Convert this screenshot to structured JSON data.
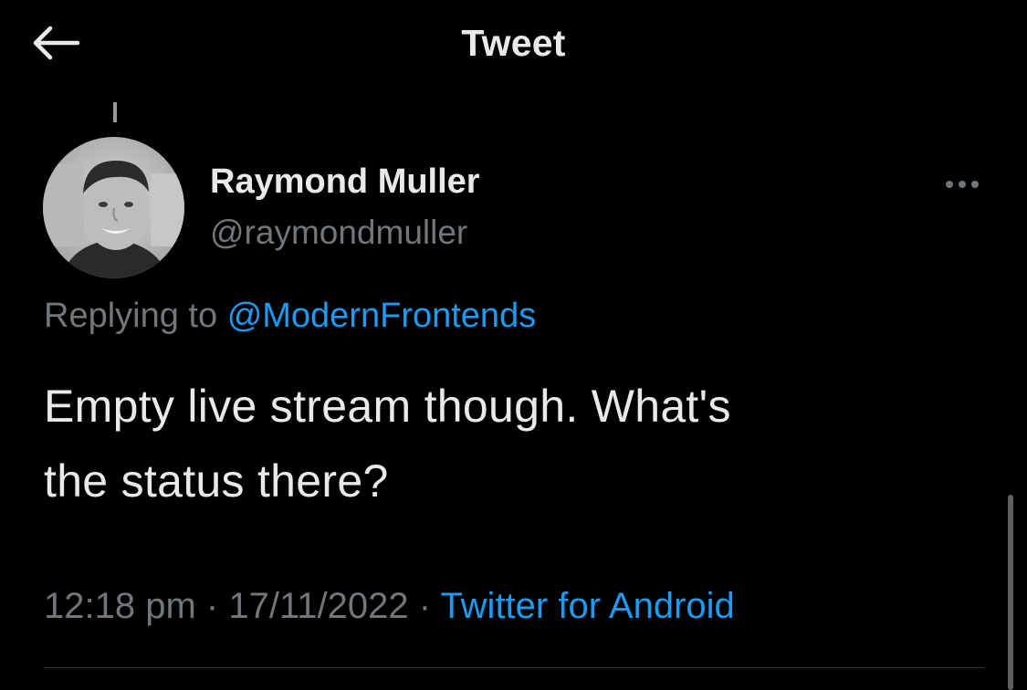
{
  "header": {
    "back_icon": "arrow-left-icon",
    "title": "Tweet"
  },
  "tweet": {
    "author": {
      "display_name": "Raymond Muller",
      "handle": "@raymondmuller",
      "avatar": "profile-photo"
    },
    "more_icon": "more-horizontal-icon",
    "replying_prefix": "Replying to",
    "replying_to": "@ModernFrontends",
    "text_line1": "Empty live stream though. What's",
    "text_line2": "the status there?",
    "time": "12:18 pm",
    "date": "17/11/2022",
    "separator": "·",
    "source": "Twitter for Android"
  },
  "colors": {
    "background": "#000000",
    "text_primary": "#e7e9ea",
    "text_secondary": "#71767b",
    "accent": "#1d9bf0"
  }
}
